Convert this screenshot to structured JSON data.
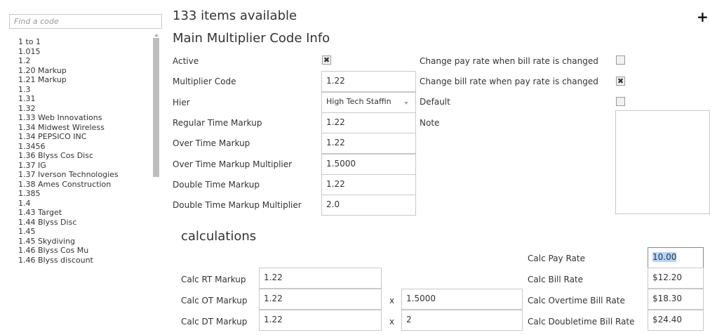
{
  "sidebar": {
    "search_placeholder": "Find a code",
    "items": [
      "1 to 1",
      "1.015",
      "1.2",
      "1.20 Markup",
      "1.21 Markup",
      "1.3",
      "1.31",
      "1.32",
      "1.33 Web Innovations",
      "1.34 Midwest Wireless",
      "1.34 PEPSICO INC",
      "1.3456",
      "1.36 Blyss Cos Disc",
      "1.37 IG",
      "1.37 Iverson Technologies",
      "1.38 Ames Construction",
      "1.385",
      "1.4",
      "1.43 Target",
      "1.44 Blyss Disc",
      "1.45",
      "1.45 Skydiving",
      "1.46 Blyss Cos Mu",
      "1.46 Blyss discount"
    ]
  },
  "header": {
    "items_available": "133 items available",
    "section_title": "Main Multiplier Code Info",
    "add_icon": "+"
  },
  "form": {
    "active_label": "Active",
    "active_checked": "✖",
    "multiplier_code_label": "Multiplier Code",
    "multiplier_code_value": "1.22",
    "hier_label": "Hier",
    "hier_value": "High Tech Staffin",
    "regular_time_markup_label": "Regular Time Markup",
    "regular_time_markup_value": "1.22",
    "over_time_markup_label": "Over Time Markup",
    "over_time_markup_value": "1.22",
    "over_time_markup_multiplier_label": "Over Time Markup Multiplier",
    "over_time_markup_multiplier_value": "1.5000",
    "double_time_markup_label": "Double Time Markup",
    "double_time_markup_value": "1.22",
    "double_time_markup_multiplier_label": "Double Time Markup Multiplier",
    "double_time_markup_multiplier_value": "2.0",
    "change_pay_rate_label": "Change pay rate when bill rate is changed",
    "change_pay_rate_checked": "",
    "change_bill_rate_label": "Change bill rate when pay rate is changed",
    "change_bill_rate_checked": "✖",
    "default_label": "Default",
    "default_checked": "",
    "note_label": "Note"
  },
  "calculations": {
    "title": "calculations",
    "rt_label": "Calc RT Markup",
    "rt_value": "1.22",
    "ot_label": "Calc OT Markup",
    "ot_value": "1.22",
    "ot_x": "x",
    "ot_multiplier": "1.5000",
    "dt_label": "Calc DT Markup",
    "dt_value": "1.22",
    "dt_x": "x",
    "dt_multiplier": "2",
    "pay_rate_label": "Calc Pay Rate",
    "pay_rate_value": "10.00",
    "bill_rate_label": "Calc Bill Rate",
    "bill_rate_value": "$12.20",
    "ot_bill_rate_label": "Calc Overtime Bill Rate",
    "ot_bill_rate_value": "$18.30",
    "dt_bill_rate_label": "Calc Doubletime Bill Rate",
    "dt_bill_rate_value": "$24.40"
  }
}
